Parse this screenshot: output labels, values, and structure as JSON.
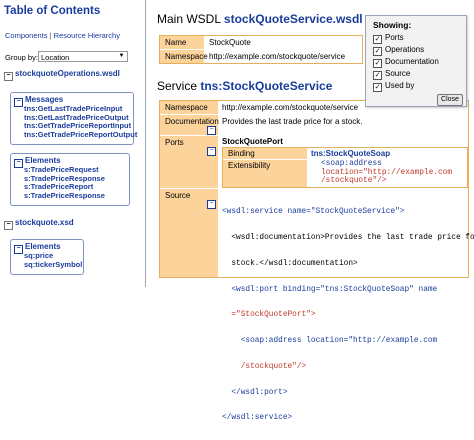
{
  "toc": {
    "title": "Table of Contents",
    "links": [
      "Components",
      "Resource Hierarchy"
    ],
    "separator": "|",
    "group_by_label": "Group by:",
    "group_by_value": "Location",
    "files": [
      {
        "name": "stockquoteOperations.wsdl",
        "groups": [
          {
            "title": "Messages",
            "items": [
              "tns:GetLastTradePriceInput",
              "tns:GetLastTradePriceOutput",
              "tns:GetTradePriceReportInput",
              "tns:GetTradePriceReportOutput"
            ]
          },
          {
            "title": "Elements",
            "items": [
              "s:TradePriceRequest",
              "s:TradePriceResponse",
              "s:TradePriceReport",
              "s:TradePriceResponse"
            ]
          }
        ]
      },
      {
        "name": "stockquote.xsd",
        "groups": [
          {
            "title": "Elements",
            "items": [
              "sq:price",
              "sq:tickerSymbol"
            ]
          }
        ]
      }
    ]
  },
  "main": {
    "wsdl_title_prefix": "Main WSDL",
    "wsdl_title_name": "stockQuoteService.wsdl",
    "wsdl_rows": [
      {
        "label": "Name",
        "value": "StockQuote"
      },
      {
        "label": "Namespace",
        "value": "http://example.com/stockquote/service"
      }
    ],
    "service_title_prefix": "Service",
    "service_title_name": "tns:StockQuoteService",
    "service_namespace_label": "Namespace",
    "service_namespace": "http://example.com/stockquote/service",
    "documentation_label": "Documentation",
    "documentation": "Provides the last trade price for a stock.",
    "ports_label": "Ports",
    "port_name": "StockQuotePort",
    "binding_label": "Binding",
    "binding_value": "tns:StockQuoteSoap",
    "extensibility_label": "Extensibility",
    "extensibility_lines": [
      "<soap:address",
      "location=\"http://example.com",
      "/stockquote\"/>"
    ],
    "source_label": "Source",
    "source_lines": [
      "<wsdl:service name=\"StockQuoteService\">",
      "  <wsdl:documentation>Provides the last trade price for a",
      "  stock.</wsdl:documentation>",
      "  <wsdl:port binding=\"tns:StockQuoteSoap\" name",
      "  =\"StockQuotePort\">",
      "    <soap:address location=\"http://example.com",
      "    /stockquote\"/>",
      "  </wsdl:port>",
      "</wsdl:service>"
    ]
  },
  "showing": {
    "title": "Showing:",
    "options": [
      {
        "label": "Ports",
        "checked": true
      },
      {
        "label": "Operations",
        "checked": true
      },
      {
        "label": "Documentation",
        "checked": true
      },
      {
        "label": "Source",
        "checked": true
      },
      {
        "label": "Used by",
        "checked": true
      }
    ],
    "close_label": "Close"
  }
}
